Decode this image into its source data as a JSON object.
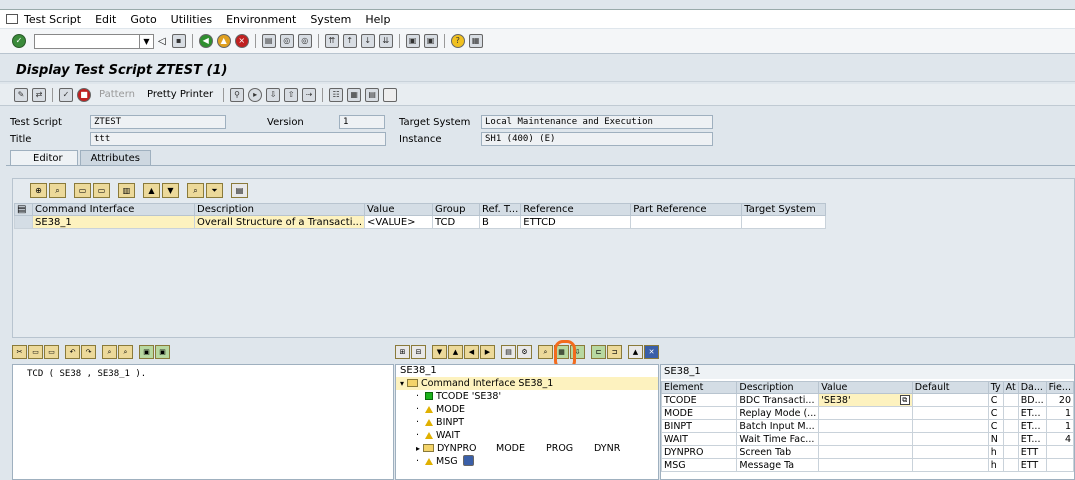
{
  "menu": {
    "items": [
      "Test Script",
      "Edit",
      "Goto",
      "Utilities",
      "Environment",
      "System",
      "Help"
    ]
  },
  "page_title": "Display Test Script ZTEST (1)",
  "toolbar2": {
    "pattern_label": "Pattern",
    "pretty_printer_label": "Pretty Printer"
  },
  "fields": {
    "test_script_label": "Test Script",
    "test_script_value": "ZTEST",
    "version_label": "Version",
    "version_value": "1",
    "target_system_label": "Target System",
    "target_system_value": "Local Maintenance and Execution",
    "title_label": "Title",
    "title_value": "ttt",
    "instance_label": "Instance",
    "instance_value": "SH1 (400) (E)"
  },
  "tabs": [
    "Editor",
    "Attributes"
  ],
  "command_grid": {
    "headers": [
      "Command Interface",
      "Description",
      "Value",
      "Group",
      "Ref. T...",
      "Reference",
      "Part Reference",
      "Target System"
    ],
    "rows": [
      [
        "SE38_1",
        "Overall Structure of a Transacti...",
        "<VALUE>",
        "TCD",
        "B",
        "ETTCD",
        "",
        ""
      ]
    ]
  },
  "code": "TCD ( SE38 , SE38_1 ).",
  "tree": {
    "header": "SE38_1",
    "root": "Command Interface SE38_1",
    "nodes": [
      {
        "label": "TCODE 'SE38'",
        "kind": "green"
      },
      {
        "label": "MODE",
        "kind": "warn"
      },
      {
        "label": "BINPT",
        "kind": "warn"
      },
      {
        "label": "WAIT",
        "kind": "warn"
      },
      {
        "label": "DYNPRO",
        "kind": "folder",
        "extra": [
          "MODE",
          "PROG",
          "DYNR"
        ]
      },
      {
        "label": "MSG",
        "kind": "warn"
      }
    ]
  },
  "param_panel": {
    "header": "SE38_1",
    "columns": [
      "Element",
      "Description",
      "Value",
      "Default",
      "Ty",
      "At",
      "Da...",
      "Fie..."
    ],
    "rows": [
      [
        "TCODE",
        "BDC Transacti...",
        "'SE38'",
        "",
        "C",
        "",
        "BD...",
        "20"
      ],
      [
        "MODE",
        "Replay Mode (...",
        "",
        "",
        "C",
        "",
        "ET...",
        "1"
      ],
      [
        "BINPT",
        "Batch Input M...",
        "",
        "",
        "C",
        "",
        "ET...",
        "1"
      ],
      [
        "WAIT",
        "Wait Time Fac...",
        "",
        "",
        "N",
        "",
        "ET...",
        "4"
      ],
      [
        "DYNPRO",
        "Screen Tab",
        "",
        "",
        "h",
        "",
        "ETT",
        ""
      ],
      [
        "MSG",
        "Message Ta",
        "",
        "",
        "h",
        "",
        "ETT",
        ""
      ]
    ]
  },
  "colors": {
    "highlight": "#f26b1d",
    "selection": "#fdf2bf",
    "background": "#dfe6ec"
  }
}
